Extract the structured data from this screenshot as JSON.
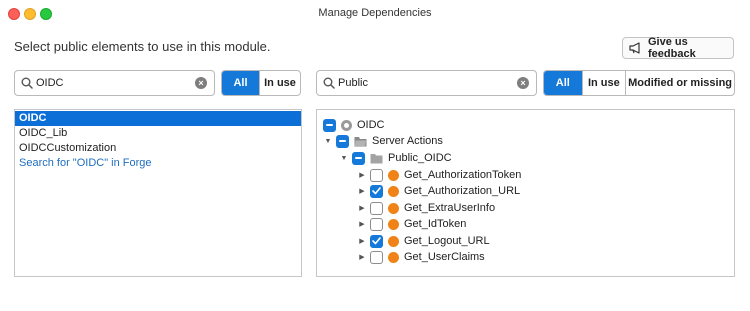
{
  "window": {
    "title": "Manage Dependencies"
  },
  "header": {
    "instruction": "Select public elements to use in this module.",
    "feedback_label": "Give us feedback"
  },
  "left": {
    "search": {
      "value": "OIDC"
    },
    "filters": [
      "All",
      "In use"
    ],
    "active_filter": "All",
    "results": [
      {
        "label": "OIDC",
        "selected": true
      },
      {
        "label": "OIDC_Lib",
        "selected": false
      },
      {
        "label": "OIDCCustomization",
        "selected": false
      },
      {
        "label": "Search for \"OIDC\" in Forge",
        "link": true
      }
    ]
  },
  "right": {
    "search": {
      "value": "Public"
    },
    "filters": [
      "All",
      "In use",
      "Modified or missing"
    ],
    "active_filter": "All",
    "tree": {
      "root": {
        "label": "OIDC",
        "state": "partial"
      },
      "folder": {
        "label": "Server Actions",
        "state": "partial"
      },
      "subfolder": {
        "label": "Public_OIDC",
        "state": "partial"
      },
      "actions": [
        {
          "label": "Get_AuthorizationToken",
          "checked": false
        },
        {
          "label": "Get_Authorization_URL",
          "checked": true
        },
        {
          "label": "Get_ExtraUserInfo",
          "checked": false
        },
        {
          "label": "Get_IdToken",
          "checked": false
        },
        {
          "label": "Get_Logout_URL",
          "checked": true
        },
        {
          "label": "Get_UserClaims",
          "checked": false
        }
      ]
    }
  },
  "colors": {
    "accent": "#1479d9",
    "action_icon": "#f08317",
    "selection": "#0c6fd8",
    "link": "#1f6ebd"
  },
  "icons": [
    "search-icon",
    "clear-icon",
    "megaphone-icon",
    "folder-icon",
    "module-icon",
    "expand-arrow-icon",
    "collapse-arrow-icon"
  ]
}
